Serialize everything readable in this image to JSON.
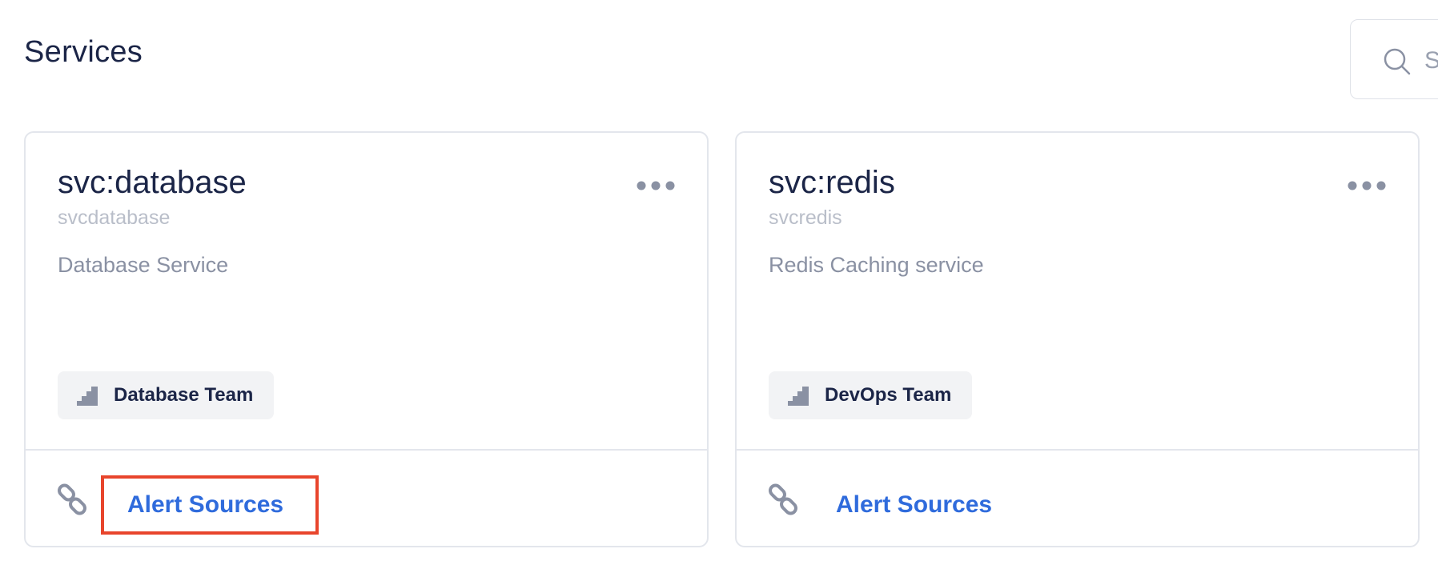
{
  "page": {
    "title": "Services"
  },
  "search": {
    "placeholder": "S"
  },
  "services": [
    {
      "title": "svc:database",
      "slug": "svcdatabase",
      "description": "Database Service",
      "team": "Database Team",
      "alert_sources_label": "Alert Sources",
      "highlighted": true
    },
    {
      "title": "svc:redis",
      "slug": "svcredis",
      "description": "Redis Caching service",
      "team": "DevOps Team",
      "alert_sources_label": "Alert Sources",
      "highlighted": false
    }
  ],
  "colors": {
    "title": "#1b2547",
    "link": "#2f6bdc",
    "highlight": "#e8452c",
    "muted": "#8a91a3"
  },
  "icons": {
    "search": "search-icon",
    "menu": "more-horizontal-icon",
    "team": "stairs-icon",
    "link": "link-icon"
  }
}
